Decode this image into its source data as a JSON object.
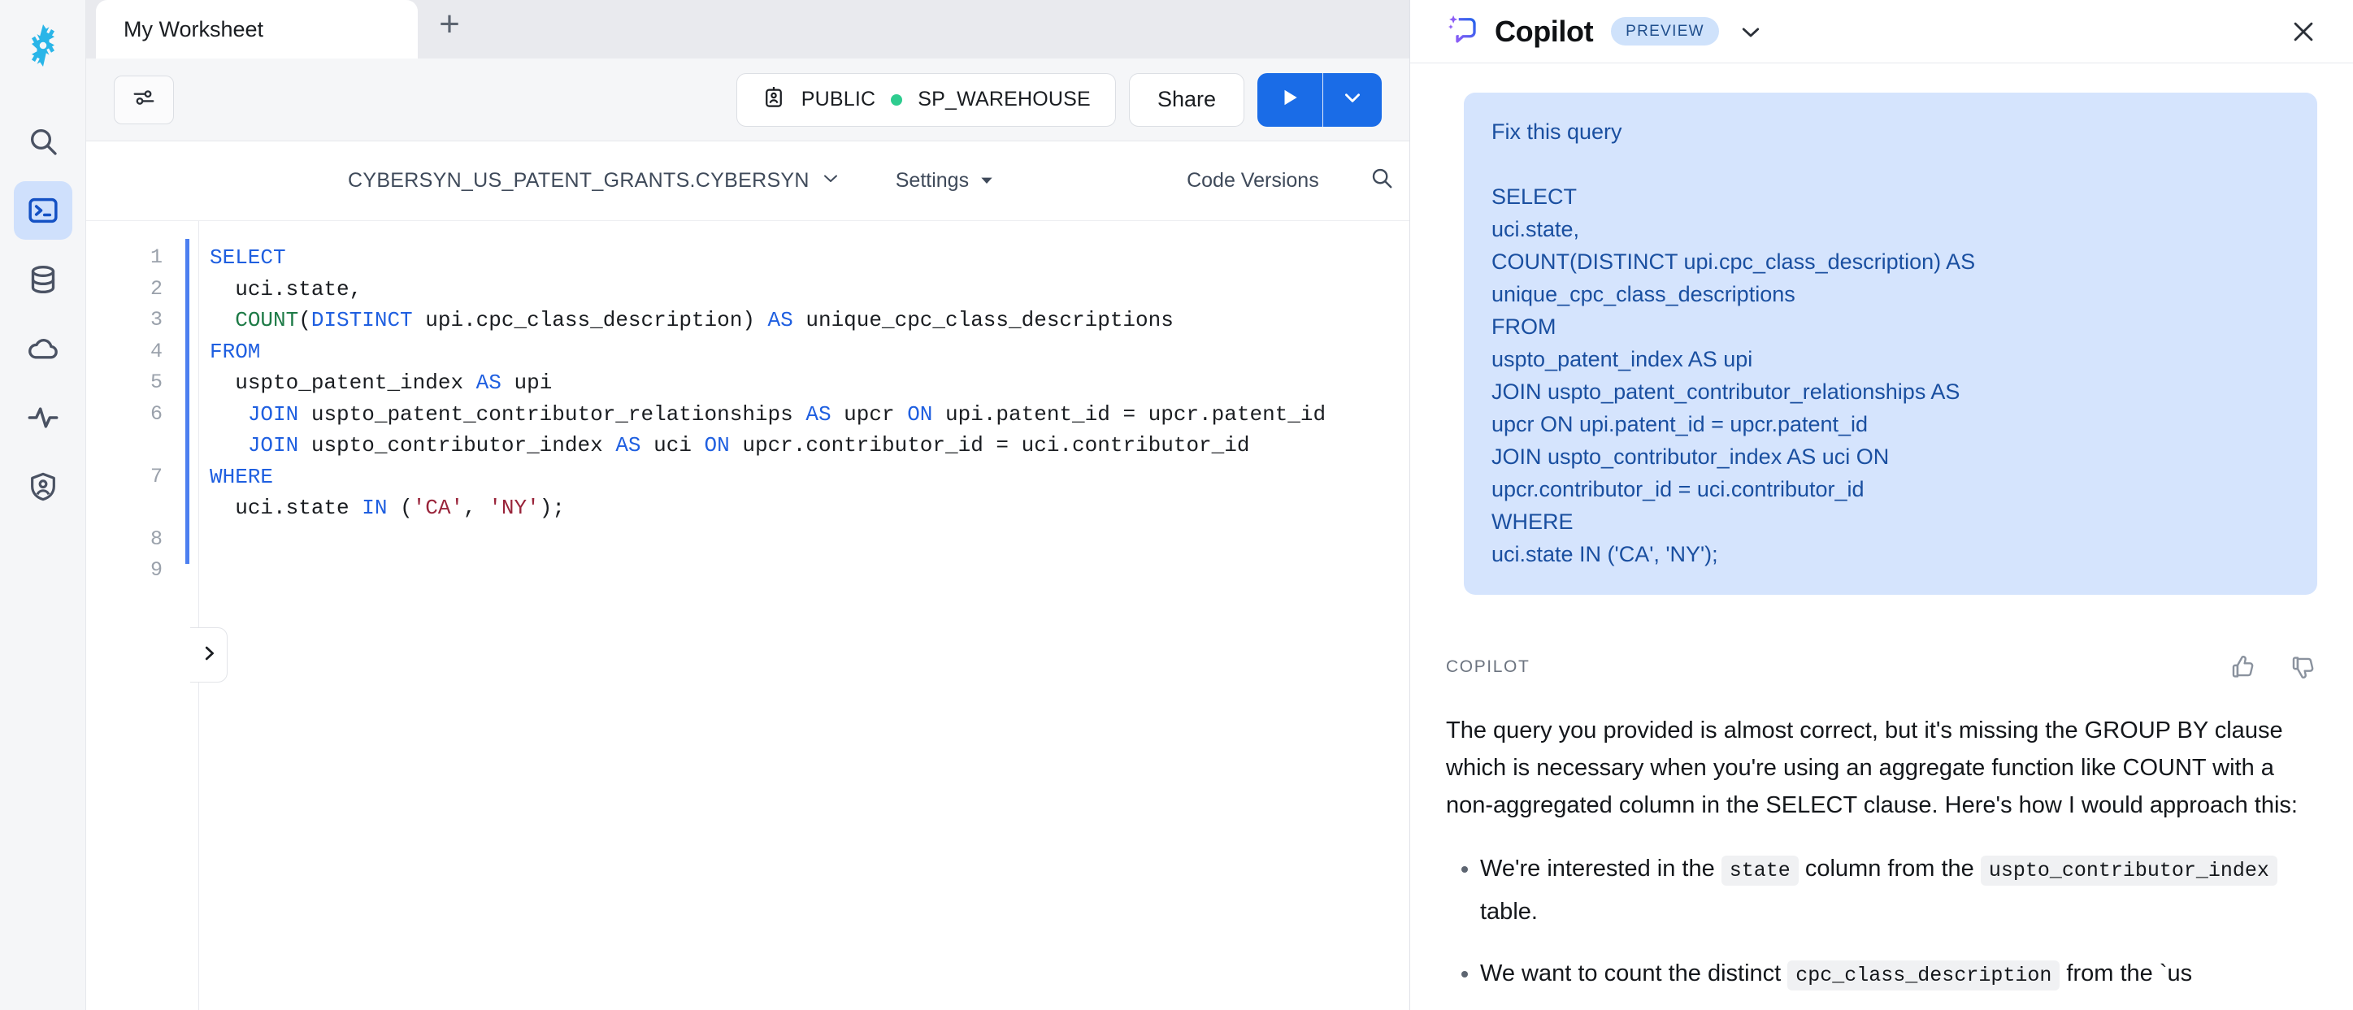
{
  "rail": {
    "logo": "snowflake-logo",
    "items": [
      {
        "icon": "search-icon",
        "name": "search",
        "active": false
      },
      {
        "icon": "worksheets-terminal-icon",
        "name": "worksheets",
        "active": true
      },
      {
        "icon": "database-icon",
        "name": "data",
        "active": false
      },
      {
        "icon": "cloud-icon",
        "name": "marketplace",
        "active": false
      },
      {
        "icon": "activity-pulse-icon",
        "name": "activity",
        "active": false
      },
      {
        "icon": "shield-user-icon",
        "name": "admin",
        "active": false
      }
    ]
  },
  "tabs": {
    "active_tab_label": "My Worksheet",
    "add_tab_label": "+"
  },
  "toolbar": {
    "filter_icon": "sliders-icon",
    "role_icon": "role-badge-icon",
    "role": "PUBLIC",
    "warehouse_status_color": "#2ecc8f",
    "warehouse": "SP_WAREHOUSE",
    "share_label": "Share",
    "run_icon": "play-icon",
    "run_caret_icon": "chevron-down-icon"
  },
  "context_bar": {
    "database_schema": "CYBERSYN_US_PATENT_GRANTS.CYBERSYN",
    "database_chevron": "chevron-down-icon",
    "settings_label": "Settings",
    "settings_chevron": "caret-down-icon",
    "code_versions_label": "Code Versions",
    "search_icon": "search-icon"
  },
  "editor": {
    "expand_handle_icon": "chevron-right-icon",
    "line_numbers": [
      "1",
      "2",
      "3",
      "4",
      "5",
      "6",
      "7",
      "8",
      "9"
    ],
    "sql_plain": "SELECT\n  uci.state,\n  COUNT(DISTINCT upi.cpc_class_description) AS unique_cpc_class_descriptions\nFROM\n  uspto_patent_index AS upi\n   JOIN uspto_patent_contributor_relationships AS upcr ON upi.patent_id = upcr.patent_id\n   JOIN uspto_contributor_index AS uci ON upcr.contributor_id = uci.contributor_id\nWHERE\n  uci.state IN ('CA', 'NY');"
  },
  "copilot": {
    "title": "Copilot",
    "badge": "PREVIEW",
    "header_chevron_icon": "chevron-down-icon",
    "close_icon": "close-icon",
    "user_message": "Fix this query\n\nSELECT\nuci.state,\nCOUNT(DISTINCT upi.cpc_class_description) AS\nunique_cpc_class_descriptions\nFROM\nuspto_patent_index AS upi\nJOIN uspto_patent_contributor_relationships AS\nupcr ON upi.patent_id = upcr.patent_id\nJOIN uspto_contributor_index AS uci ON\nupcr.contributor_id = uci.contributor_id\nWHERE\nuci.state IN ('CA', 'NY');",
    "response_author": "COPILOT",
    "thumbs_up_icon": "thumbs-up-icon",
    "thumbs_down_icon": "thumbs-down-icon",
    "response_paragraph": "The query you provided is almost correct, but it's missing the GROUP BY clause which is necessary when you're using an aggregate function like COUNT with a non-aggregated column in the SELECT clause. Here's how I would approach this:",
    "bullets": [
      {
        "before": "We're interested in the ",
        "code1": "state",
        "middle": " column from the ",
        "code2": "uspto_contributor_index",
        "after": " table."
      },
      {
        "before": "We want to count the distinct ",
        "code1": "cpc_class_description",
        "middle": " from the `us",
        "code2": "",
        "after": ""
      }
    ]
  }
}
